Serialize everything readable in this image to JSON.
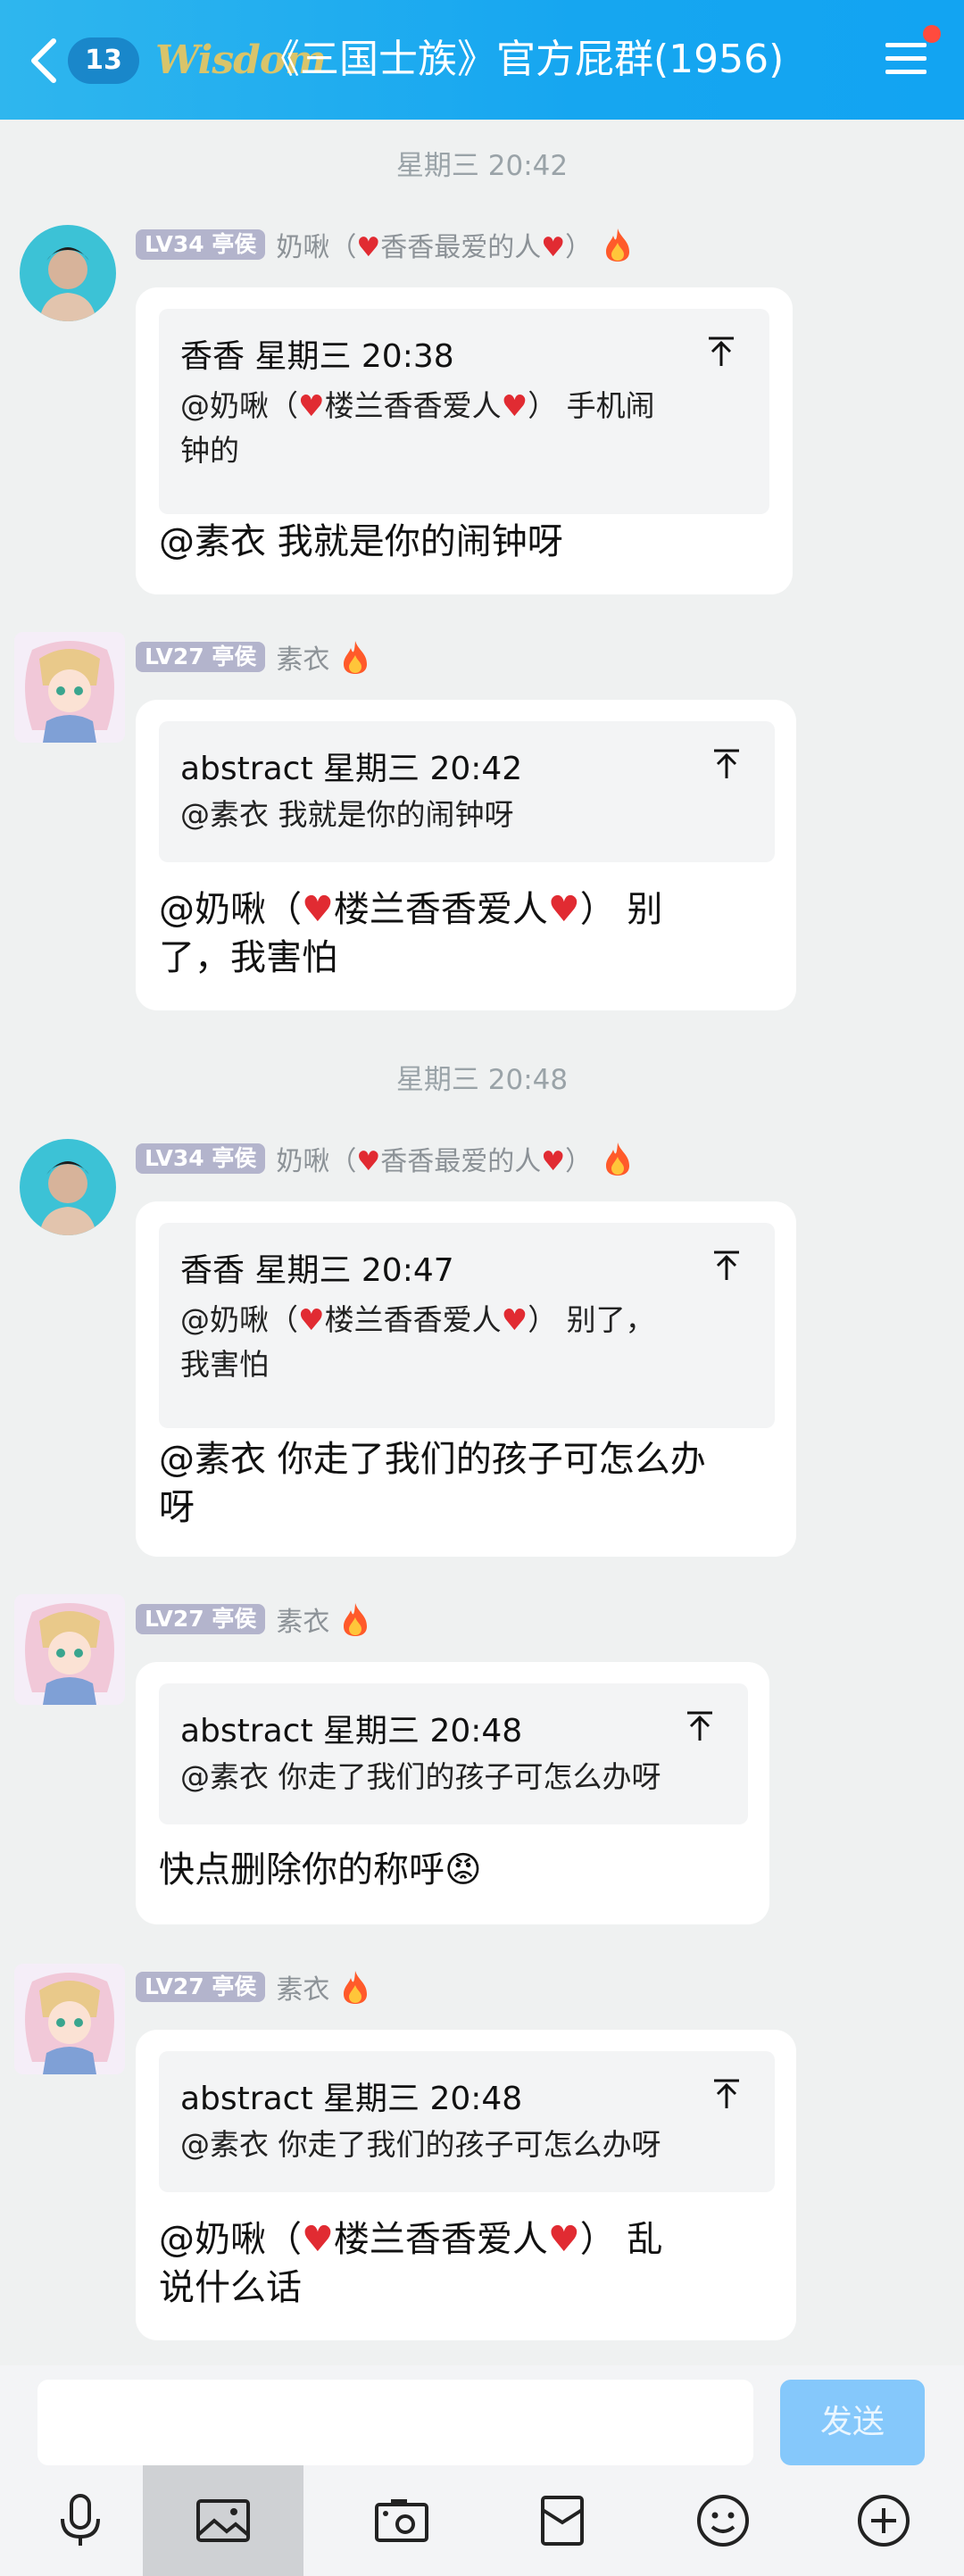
{
  "header": {
    "unread_count": "13",
    "logo_text": "Wisdom",
    "title": "《三国士族》官方屁群(1956)"
  },
  "messages": [
    {
      "timestamp": "星期三 20:42",
      "level": "LV34 亭侯",
      "nick": "奶啾（♥香香最爱的人♥）",
      "quote_head": "香香 星期三 20:38",
      "quote_body_1": "@奶啾（♥楼兰香香爱人♥） 手机闹",
      "quote_body_2": "钟的",
      "text_1": "@素衣 我就是你的闹钟呀"
    },
    {
      "level": "LV27 亭侯",
      "nick": "素衣",
      "quote_head": "abstract 星期三 20:42",
      "quote_body_1": "@素衣 我就是你的闹钟呀",
      "text_1": "@奶啾（♥楼兰香香爱人♥） 别",
      "text_2": "了，我害怕"
    },
    {
      "timestamp": "星期三 20:48",
      "level": "LV34 亭侯",
      "nick": "奶啾（♥香香最爱的人♥）",
      "quote_head": "香香 星期三 20:47",
      "quote_body_1": "@奶啾（♥楼兰香香爱人♥） 别了，",
      "quote_body_2": "我害怕",
      "text_1": "@素衣 你走了我们的孩子可怎么办",
      "text_2": "呀"
    },
    {
      "level": "LV27 亭侯",
      "nick": "素衣",
      "quote_head": "abstract 星期三 20:48",
      "quote_body_1": "@素衣 你走了我们的孩子可怎么办呀",
      "text_1": "快点删除你的称呼😡"
    },
    {
      "level": "LV27 亭侯",
      "nick": "素衣",
      "quote_head": "abstract 星期三 20:48",
      "quote_body_1": "@素衣 你走了我们的孩子可怎么办呀",
      "text_1": "@奶啾（♥楼兰香香爱人♥） 乱",
      "text_2": "说什么话"
    }
  ],
  "input": {
    "placeholder": "",
    "send_label": "发送"
  },
  "toolbar": {
    "icons": [
      "microphone-icon",
      "image-icon",
      "camera-icon",
      "red-packet-icon",
      "emoji-icon",
      "plus-icon"
    ],
    "active": "image-icon"
  },
  "colors": {
    "header_blue": "#16a6f0",
    "send_button": "#85c8fb",
    "level_badge": "#b3b4cc",
    "unread_dot": "#ff4b3e"
  }
}
